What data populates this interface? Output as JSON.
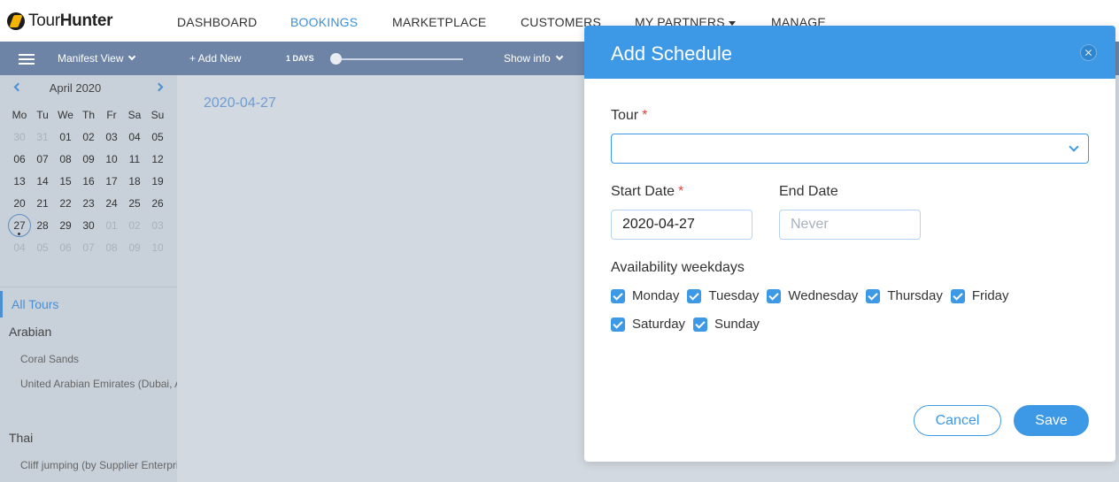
{
  "brand": {
    "name_light": "Tour",
    "name_bold": "Hunter"
  },
  "nav": {
    "dashboard": "DASHBOARD",
    "bookings": "BOOKINGS",
    "marketplace": "MARKETPLACE",
    "customers": "CUSTOMERS",
    "my_partners": "MY PARTNERS",
    "manage": "MANAGE",
    "active": "bookings"
  },
  "toolbar": {
    "view": "Manifest View",
    "add_new": "+ Add New",
    "days": "1 DAYS",
    "show_info": "Show info"
  },
  "calendar": {
    "month": "April 2020",
    "weekdays": [
      "Mo",
      "Tu",
      "We",
      "Th",
      "Fr",
      "Sa",
      "Su"
    ],
    "weeks": [
      [
        "30",
        "31",
        "01",
        "02",
        "03",
        "04",
        "05"
      ],
      [
        "06",
        "07",
        "08",
        "09",
        "10",
        "11",
        "12"
      ],
      [
        "13",
        "14",
        "15",
        "16",
        "17",
        "18",
        "19"
      ],
      [
        "20",
        "21",
        "22",
        "23",
        "24",
        "25",
        "26"
      ],
      [
        "27",
        "28",
        "29",
        "30",
        "01",
        "02",
        "03"
      ],
      [
        "04",
        "05",
        "06",
        "07",
        "08",
        "09",
        "10"
      ]
    ],
    "today": "27"
  },
  "sidebar": {
    "all_tours": "All Tours",
    "groups": [
      {
        "title": "Arabian",
        "items": [
          "Coral Sands",
          "United Arabian Emirates (Dubai, Abu Dhabi)"
        ]
      },
      {
        "title": "Thai",
        "items": [
          "Cliff jumping (by Supplier Enterprises)"
        ]
      }
    ]
  },
  "main": {
    "date": "2020-04-27"
  },
  "modal": {
    "title": "Add Schedule",
    "tour_label": "Tour",
    "tour_value": "",
    "start_label": "Start Date",
    "start_value": "2020-04-27",
    "end_label": "End Date",
    "end_placeholder": "Never",
    "weekdays_label": "Availability weekdays",
    "weekdays": [
      {
        "label": "Monday",
        "checked": true
      },
      {
        "label": "Tuesday",
        "checked": true
      },
      {
        "label": "Wednesday",
        "checked": true
      },
      {
        "label": "Thursday",
        "checked": true
      },
      {
        "label": "Friday",
        "checked": true
      },
      {
        "label": "Saturday",
        "checked": true
      },
      {
        "label": "Sunday",
        "checked": true
      }
    ],
    "cancel": "Cancel",
    "save": "Save"
  },
  "colors": {
    "accent": "#3d98e6",
    "toolbar": "#6d84a6",
    "sidebar": "#c8d0d9",
    "required": "#e2453c"
  }
}
